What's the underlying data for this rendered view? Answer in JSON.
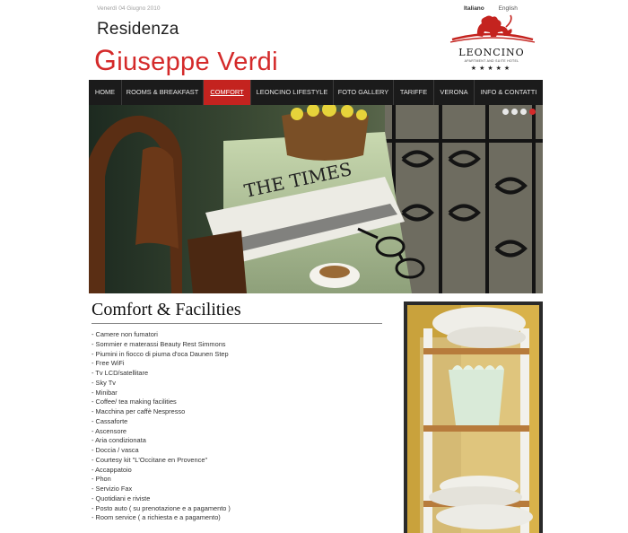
{
  "header": {
    "date": "Venerdì 04 Giugno 2010",
    "languages": [
      {
        "label": "Italiano",
        "active": true
      },
      {
        "label": "English",
        "active": false
      }
    ],
    "brand_line1": "Residenza",
    "brand_line2_initial": "G",
    "brand_line2_rest": "iuseppe Verdi",
    "logo": {
      "name": "LEONCINO",
      "tagline": "APARTMENT AND SUITE HOTEL",
      "stars": "★★★★★",
      "icon": "lion-icon"
    }
  },
  "nav": {
    "items": [
      {
        "label": "HOME",
        "active": false
      },
      {
        "label": "ROOMS & BREAKFAST",
        "active": false
      },
      {
        "label": "COMFORT",
        "active": true
      },
      {
        "label": "LEONCINO LIFESTYLE",
        "active": false
      },
      {
        "label": "FOTO GALLERY",
        "active": false
      },
      {
        "label": "TARIFFE",
        "active": false
      },
      {
        "label": "VERONA",
        "active": false
      },
      {
        "label": "INFO & CONTATTI",
        "active": false
      }
    ]
  },
  "slider": {
    "count": 4,
    "active_index": 3
  },
  "main": {
    "title": "Comfort & Facilities",
    "items": [
      "- Camere non fumatori",
      "- Sommier e materassi  Beauty Rest  Simmons",
      "- Piumini in fiocco di piuma d'oca Daunen Step",
      "- Free WiFi",
      "- Tv LCD/satellitare",
      "- Sky Tv",
      "- Minibar",
      "- Coffee/ tea making facilities",
      "- Macchina per caffè Nespresso",
      "- Cassaforte",
      "- Ascensore",
      "- Aria condizionata",
      "- Doccia / vasca",
      "- Courtesy kit \"L'Occitane en Provence\"",
      "- Accappatoio",
      "- Phon",
      "- Servizio Fax",
      "- Quotidiani e riviste",
      "- Posto auto ( su prenotazione e a pagamento )",
      "- Room service ( a richiesta e a pagamento)"
    ]
  },
  "colors": {
    "accent": "#d42a2a",
    "nav_bg": "#1b1b1b",
    "nav_active": "#c4231f"
  }
}
